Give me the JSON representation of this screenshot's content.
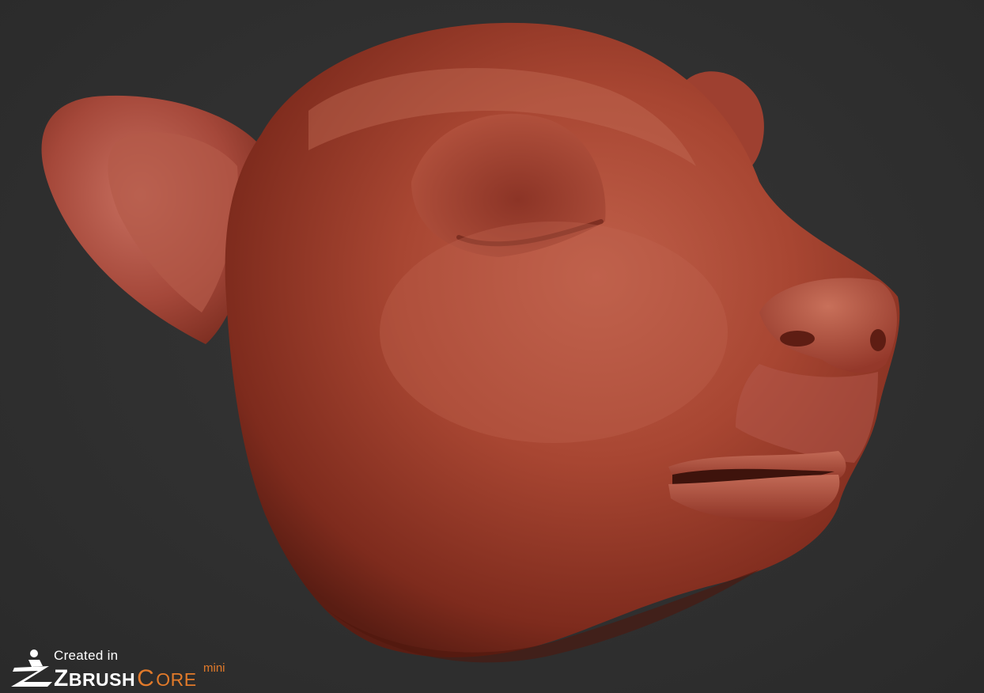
{
  "viewport": {
    "background_color": "#2e2e2e",
    "model_color": "#a8432f"
  },
  "watermark": {
    "created_label": "Created in",
    "brand_first": "Z",
    "brand_rest": "BRUSH",
    "brand_core_first": "C",
    "brand_core_rest": "ORE",
    "brand_mini": "mini",
    "accent_color": "#e27a2a",
    "icon": "zbrush-logo-icon"
  }
}
